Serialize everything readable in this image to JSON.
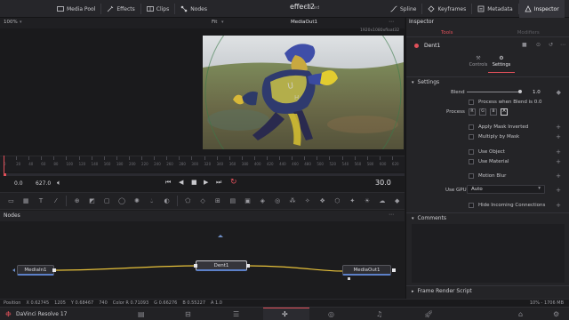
{
  "topbar": {
    "media_pool": "Media Pool",
    "effects": "Effects",
    "clips": "Clips",
    "nodes": "Nodes",
    "title": "effect2",
    "edited": "Edited",
    "spline": "Spline",
    "keyframes": "Keyframes",
    "metadata": "Metadata",
    "inspector": "Inspector"
  },
  "viewer": {
    "zoom": "100%",
    "fit": "Fit",
    "output": "MediaOut1",
    "resolution": "1920x1080xfloat32"
  },
  "ruler": {
    "ticks": [
      "0",
      "20",
      "40",
      "60",
      "80",
      "100",
      "120",
      "140",
      "160",
      "180",
      "200",
      "220",
      "240",
      "260",
      "280",
      "300",
      "320",
      "340",
      "360",
      "380",
      "400",
      "420",
      "440",
      "460",
      "480",
      "500",
      "520",
      "540",
      "560",
      "580",
      "600",
      "620"
    ]
  },
  "transport": {
    "start": "0.0",
    "end": "627.0",
    "current": "30.0"
  },
  "nodes_panel": {
    "title": "Nodes",
    "node1": "MediaIn1",
    "node2": "Dent1",
    "node3": "MediaOut1"
  },
  "status": {
    "position": "Position",
    "x": "X  0.62745",
    "px": "1205",
    "y": "Y  0.68467",
    "py": "740",
    "color": "Color R  0.71093",
    "g": "G  0.66276",
    "b": "B  0.55227",
    "a": "A  1.0",
    "mem": "10% - 1706 MB"
  },
  "pagebar": {
    "app": "DaVinci Resolve 17"
  },
  "inspector": {
    "title": "Inspector",
    "tab_tools": "Tools",
    "tab_modifiers": "Modifiers",
    "tool_name": "Dent1",
    "controls": "Controls",
    "settings": "Settings",
    "section_settings": "Settings",
    "blend_label": "Blend",
    "blend_value": "1.0",
    "blend_fraction": 1.0,
    "process_when_blend": "Process when Blend is 0.0",
    "process_label": "Process",
    "process_r": "R",
    "process_g": "G",
    "process_b": "B",
    "process_a": "A",
    "apply_mask_inverted": "Apply Mask Inverted",
    "multiply_by_mask": "Multiply by Mask",
    "use_object": "Use Object",
    "use_material": "Use Material",
    "motion_blur": "Motion Blur",
    "use_gpu_label": "Use GPU",
    "use_gpu_value": "Auto",
    "hide_incoming": "Hide Incoming Connections",
    "comments": "Comments",
    "frame_render_script": "Frame Render Script"
  },
  "colors": {
    "accent_red": "#e0505a",
    "connector_yellow": "#e8c23a",
    "node_blue": "#6f8fc8"
  }
}
